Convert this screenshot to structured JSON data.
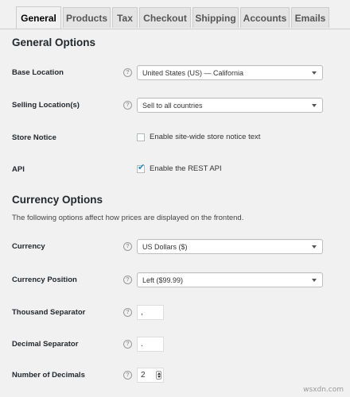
{
  "tabs": [
    "General",
    "Products",
    "Tax",
    "Checkout",
    "Shipping",
    "Accounts",
    "Emails"
  ],
  "general": {
    "title": "General Options",
    "base_location": {
      "label": "Base Location",
      "value": "United States (US) — California"
    },
    "selling_locations": {
      "label": "Selling Location(s)",
      "value": "Sell to all countries"
    },
    "store_notice": {
      "label": "Store Notice",
      "checkbox_label": "Enable site-wide store notice text",
      "checked": false
    },
    "api": {
      "label": "API",
      "checkbox_label": "Enable the REST API",
      "checked": true
    }
  },
  "currency": {
    "title": "Currency Options",
    "description": "The following options affect how prices are displayed on the frontend.",
    "currency": {
      "label": "Currency",
      "value": "US Dollars ($)"
    },
    "position": {
      "label": "Currency Position",
      "value": "Left ($99.99)"
    },
    "thousand_sep": {
      "label": "Thousand Separator",
      "value": ","
    },
    "decimal_sep": {
      "label": "Decimal Separator",
      "value": "."
    },
    "decimals": {
      "label": "Number of Decimals",
      "value": "2"
    }
  },
  "help_glyph": "?",
  "check_glyph": "✔",
  "watermark": "wsxdn.com",
  "colors": {
    "accent": "#1e8cbe",
    "background": "#f1f1f1"
  }
}
